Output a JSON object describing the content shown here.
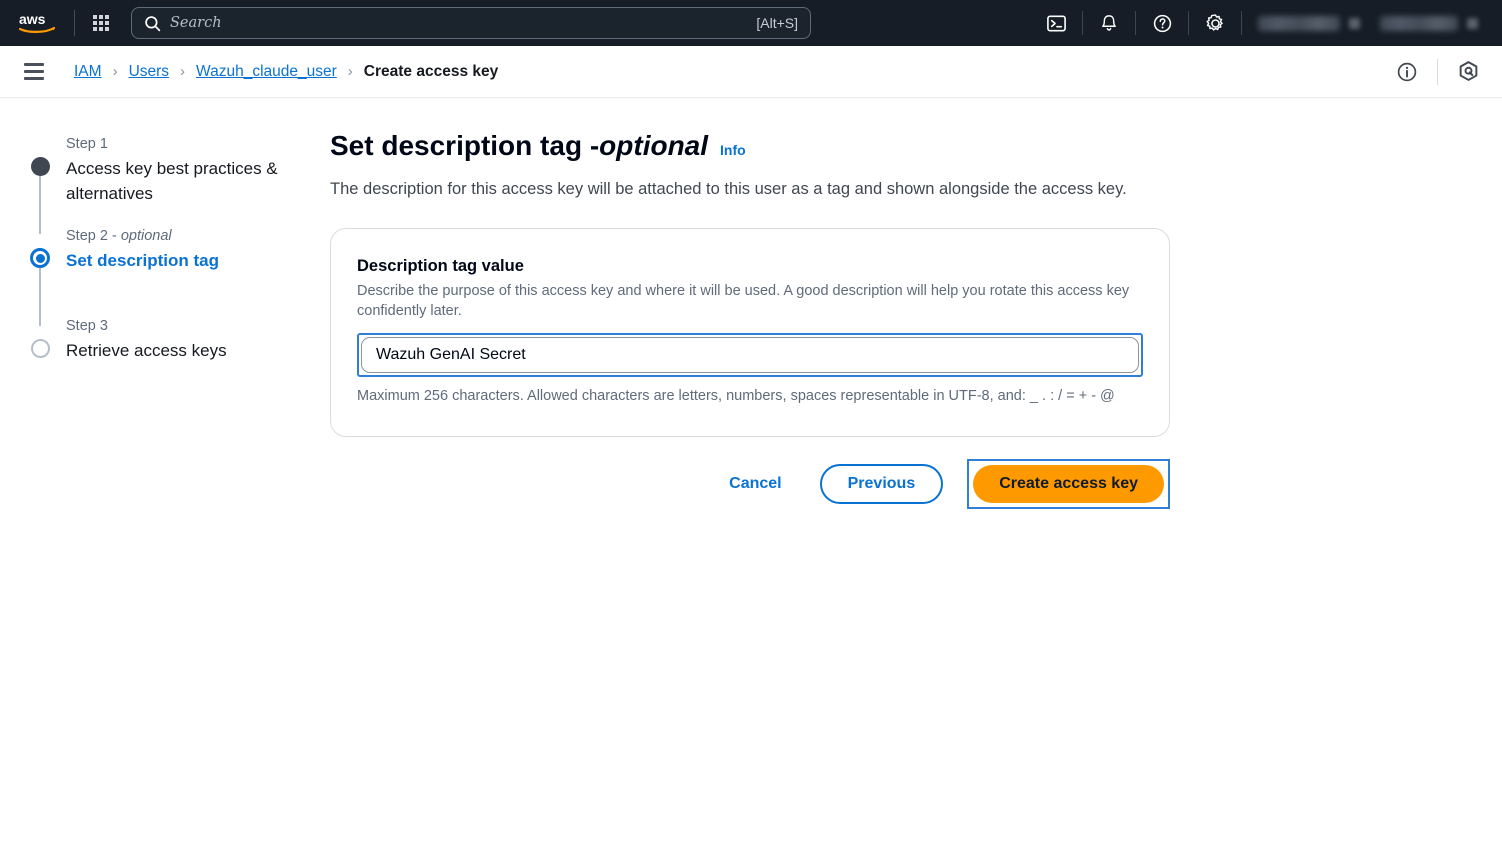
{
  "topnav": {
    "logo": "aws",
    "apps_icon": "apps-grid-icon",
    "search": {
      "placeholder": "Search",
      "shortcut": "[Alt+S]",
      "icon": "search-icon"
    },
    "icons": [
      {
        "name": "cloudshell-icon"
      },
      {
        "name": "notifications-bell-icon"
      },
      {
        "name": "help-question-icon"
      },
      {
        "name": "settings-gear-icon"
      }
    ],
    "redacted": [
      {
        "name": "region-selector",
        "label": ""
      },
      {
        "name": "account-menu",
        "label": ""
      }
    ]
  },
  "breadcrumb": {
    "menu_icon": "hamburger-menu-icon",
    "separator": "›",
    "items": [
      {
        "label": "IAM",
        "link": true
      },
      {
        "label": "Users",
        "link": true
      },
      {
        "label": "Wazuh_claude_user",
        "link": true
      },
      {
        "label": "Create access key",
        "link": false
      }
    ],
    "right_icons": [
      {
        "name": "info-circle-icon"
      },
      {
        "name": "amazon-q-icon"
      }
    ]
  },
  "stepper": {
    "steps": [
      {
        "label": "Step 1",
        "optional_suffix": "",
        "title": "Access key best practices & alternatives",
        "state": "done"
      },
      {
        "label": "Step 2 - ",
        "optional_suffix": "optional",
        "title": "Set description tag",
        "state": "current"
      },
      {
        "label": "Step 3",
        "optional_suffix": "",
        "title": "Retrieve access keys",
        "state": "todo"
      }
    ]
  },
  "main": {
    "title_main": "Set description tag - ",
    "title_italic": "optional",
    "info_label": "Info",
    "description": "The description for this access key will be attached to this user as a tag and shown alongside the access key.",
    "card": {
      "field_label": "Description tag value",
      "field_hint": "Describe the purpose of this access key and where it will be used. A good description will help you rotate this access key confidently later.",
      "input_value": "Wazuh GenAI Secret",
      "input_placeholder": "",
      "constraint": "Maximum 256 characters. Allowed characters are letters, numbers, spaces representable in UTF-8, and: _ . : / = + - @"
    },
    "actions": {
      "cancel_label": "Cancel",
      "previous_label": "Previous",
      "create_label": "Create access key"
    }
  },
  "colors": {
    "nav_background": "#161d26",
    "link_blue": "#0972d3",
    "focus_blue": "#2f7fd6",
    "primary_orange": "#ff9900",
    "text_dark": "#000716",
    "text_muted": "#5f6b7a",
    "border_gray": "#d9dde1"
  }
}
